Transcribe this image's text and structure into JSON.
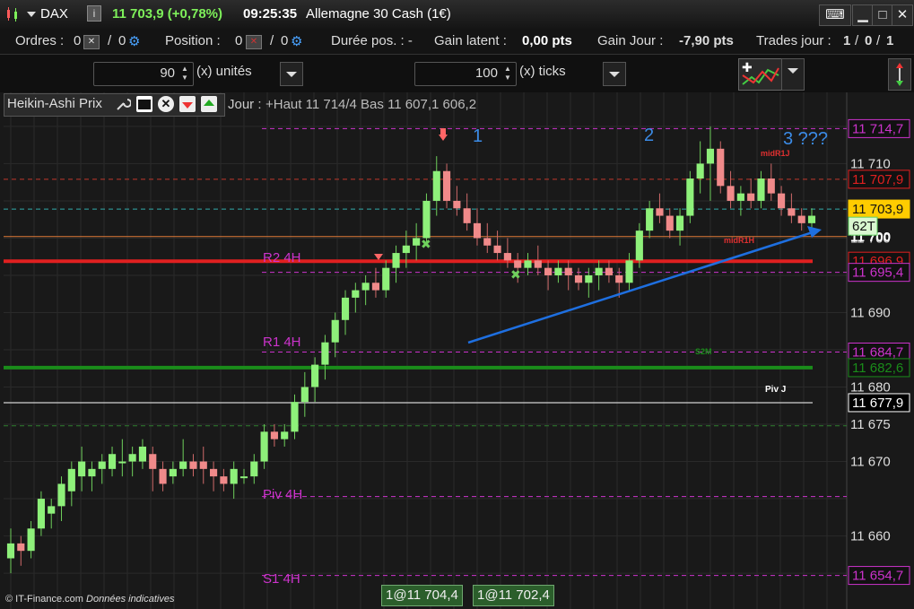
{
  "titlebar": {
    "symbol": "DAX",
    "info": "i",
    "price": "11 703,9 (+0,78%)",
    "time": "09:25:35",
    "instrument": "Allemagne 30 Cash (1€)"
  },
  "orders": {
    "ordres_label": "Ordres :",
    "ordres_v1": "0",
    "ordres_sep": "/",
    "ordres_v2": "0",
    "position_label": "Position :",
    "position_v1": "0",
    "position_sep": "/",
    "position_v2": "0",
    "duree_label": "Durée pos. : -",
    "gain_latent_label": "Gain latent :",
    "gain_latent_value": "0,00 pts",
    "gain_jour_label": "Gain Jour :",
    "gain_jour_value": "-7,90 pts",
    "trades_label": "Trades jour :",
    "trades_v1": "1",
    "trades_v2": "0",
    "trades_v3": "1",
    "slash": "/"
  },
  "toolbar": {
    "qty_value": "90",
    "qty_unit": "(x) unités",
    "ticks_value": "100",
    "ticks_unit": "(x) ticks"
  },
  "chart_header": {
    "name": "Heikin-Ashi Prix",
    "jour": "Jour :",
    "ohlc_overlap": "+Haut 11 714/4 Bas 11 607,1 606,2"
  },
  "chart_data": {
    "type": "candlestick",
    "style": "heikin-ashi",
    "y_ticks": [
      11660,
      11665,
      11670,
      11675,
      11680,
      11685,
      11690,
      11695,
      11700,
      11705,
      11710,
      11715
    ],
    "y_tick_labels": [
      "11 660",
      "11 670",
      "11 675",
      "11 680",
      "11 690",
      "11 700",
      "11 710"
    ],
    "current": "11 700",
    "ylim": [
      11652,
      11718
    ],
    "levels": [
      {
        "name": "R2 4H",
        "price": 11695.4,
        "label": "11 695,4",
        "color": "#cc33cc",
        "style": "dashed"
      },
      {
        "name": "R1 4H",
        "price": 11684.7,
        "label": "11 684,7",
        "color": "#cc33cc",
        "style": "dashed"
      },
      {
        "name": "Piv 4H",
        "price": 11665.3,
        "label": "",
        "color": "#cc33cc",
        "style": "dashed"
      },
      {
        "name": "S1 4H",
        "price": 11654.7,
        "label": "11 654,7",
        "color": "#cc33cc",
        "style": "dashed"
      },
      {
        "name": "",
        "price": 11714.7,
        "label": "11 714,7",
        "color": "#cc33cc",
        "style": "dashed"
      },
      {
        "name": "",
        "price": 11707.9,
        "label": "11 707,9",
        "color": "#c0392b",
        "style": "dashed"
      },
      {
        "name": "",
        "price": 11703.9,
        "label": "11 703,9",
        "color": "#3aa",
        "style": "dashed"
      },
      {
        "name": "",
        "price": 11700.2,
        "label": "",
        "color": "#e07b39",
        "style": "solid"
      },
      {
        "name": "",
        "price": 11696.9,
        "label": "11 696,9",
        "color": "#e02020",
        "style": "solid"
      },
      {
        "name": "",
        "price": 11682.6,
        "label": "11 682,6",
        "color": "#1a8c1a",
        "style": "solid"
      },
      {
        "name": "Piv J",
        "price": 11677.9,
        "label": "11 677,9",
        "color": "#ffffff",
        "style": "solid"
      },
      {
        "name": "",
        "price": 11674.8,
        "label": "",
        "color": "#2f7f2f",
        "style": "dashed"
      }
    ],
    "price_badges": [
      {
        "text": "11 714,7",
        "color": "#cc33cc"
      },
      {
        "text": "11 707,9",
        "color": "#e02020"
      },
      {
        "text": "11 703,9",
        "color": "#ffcc00"
      },
      {
        "text": "62T",
        "color": "#5fcf5f"
      },
      {
        "text": "11 696,9",
        "color": "#e02020"
      },
      {
        "text": "11 695,4",
        "color": "#cc33cc"
      },
      {
        "text": "11 684,7",
        "color": "#cc33cc"
      },
      {
        "text": "11 682,6",
        "color": "#1a8c1a"
      },
      {
        "text": "11 677,9",
        "color": "#ffffff"
      },
      {
        "text": "11 654,7",
        "color": "#cc33cc"
      }
    ],
    "annotations": [
      "1",
      "2",
      "3 ???",
      "midR1J",
      "midR1H",
      "S2M",
      "Piv J",
      "R2 4H",
      "R1 4H",
      "Piv 4H",
      "S1 4H"
    ],
    "candles": [
      [
        11657,
        11661,
        11655,
        11659
      ],
      [
        11659,
        11660,
        11656,
        11658
      ],
      [
        11658,
        11662,
        11657,
        11661
      ],
      [
        11661,
        11666,
        11660,
        11665
      ],
      [
        11663,
        11665,
        11661,
        11664
      ],
      [
        11664,
        11668,
        11662,
        11667
      ],
      [
        11666,
        11670,
        11664,
        11669
      ],
      [
        11668,
        11672,
        11666,
        11670
      ],
      [
        11668,
        11670,
        11666,
        11669
      ],
      [
        11669,
        11671,
        11667,
        11670
      ],
      [
        11669,
        11672,
        11668,
        11671
      ],
      [
        11670,
        11673,
        11668,
        11670
      ],
      [
        11670,
        11672,
        11668,
        11671
      ],
      [
        11670,
        11673,
        11669,
        11672
      ],
      [
        11671,
        11672,
        11666,
        11669
      ],
      [
        11669,
        11670,
        11666,
        11667
      ],
      [
        11668,
        11670,
        11667,
        11669
      ],
      [
        11669,
        11673,
        11668,
        11670
      ],
      [
        11670,
        11671,
        11668,
        11669
      ],
      [
        11670,
        11672,
        11667,
        11669
      ],
      [
        11669,
        11670,
        11666,
        11668
      ],
      [
        11668,
        11669,
        11666,
        11667
      ],
      [
        11667,
        11670,
        11665,
        11669
      ],
      [
        11668,
        11669,
        11667,
        11668
      ],
      [
        11668,
        11671,
        11667,
        11670
      ],
      [
        11670,
        11675,
        11669,
        11674
      ],
      [
        11674,
        11675,
        11672,
        11673
      ],
      [
        11673,
        11675,
        11672,
        11674
      ],
      [
        11674,
        11679,
        11673,
        11678
      ],
      [
        11678,
        11682,
        11676,
        11680
      ],
      [
        11680,
        11684,
        11678,
        11683
      ],
      [
        11683,
        11687,
        11681,
        11686
      ],
      [
        11686,
        11690,
        11684,
        11689
      ],
      [
        11689,
        11693,
        11687,
        11692
      ],
      [
        11692,
        11694,
        11690,
        11693
      ],
      [
        11693,
        11695,
        11691,
        11694
      ],
      [
        11694,
        11696,
        11692,
        11693
      ],
      [
        11693,
        11697,
        11692,
        11696
      ],
      [
        11696,
        11699,
        11694,
        11698
      ],
      [
        11698,
        11701,
        11696,
        11699
      ],
      [
        11699,
        11702,
        11697,
        11700
      ],
      [
        11700,
        11706,
        11699,
        11705
      ],
      [
        11705,
        11711,
        11703,
        11709
      ],
      [
        11709,
        11710,
        11704,
        11705
      ],
      [
        11705,
        11707,
        11703,
        11704
      ],
      [
        11704,
        11706,
        11701,
        11702
      ],
      [
        11702,
        11704,
        11699,
        11700
      ],
      [
        11700,
        11702,
        11698,
        11699
      ],
      [
        11699,
        11701,
        11697,
        11698
      ],
      [
        11698,
        11700,
        11696,
        11697
      ],
      [
        11697,
        11698,
        11694,
        11696
      ],
      [
        11696,
        11698,
        11695,
        11697
      ],
      [
        11697,
        11699,
        11695,
        11696
      ],
      [
        11696,
        11697,
        11693,
        11695
      ],
      [
        11695,
        11697,
        11694,
        11696
      ],
      [
        11696,
        11697,
        11693,
        11695
      ],
      [
        11695,
        11696,
        11693,
        11694
      ],
      [
        11694,
        11696,
        11692,
        11695
      ],
      [
        11695,
        11697,
        11693,
        11696
      ],
      [
        11696,
        11697,
        11694,
        11695
      ],
      [
        11695,
        11696,
        11692,
        11694
      ],
      [
        11694,
        11698,
        11693,
        11697
      ],
      [
        11697,
        11702,
        11696,
        11701
      ],
      [
        11701,
        11705,
        11700,
        11704
      ],
      [
        11704,
        11706,
        11702,
        11703
      ],
      [
        11703,
        11704,
        11700,
        11701
      ],
      [
        11701,
        11704,
        11699,
        11703
      ],
      [
        11703,
        11709,
        11702,
        11708
      ],
      [
        11708,
        11713,
        11706,
        11710
      ],
      [
        11710,
        11715,
        11705,
        11712
      ],
      [
        11712,
        11713,
        11706,
        11707
      ],
      [
        11707,
        11709,
        11704,
        11705
      ],
      [
        11705,
        11707,
        11703,
        11706
      ],
      [
        11706,
        11708,
        11704,
        11705
      ],
      [
        11705,
        11709,
        11704,
        11708
      ],
      [
        11708,
        11710,
        11705,
        11706
      ],
      [
        11706,
        11707,
        11703,
        11704
      ],
      [
        11704,
        11706,
        11702,
        11703
      ],
      [
        11703,
        11704,
        11701,
        11702
      ],
      [
        11702,
        11704,
        11701,
        11703
      ]
    ]
  },
  "footer": {
    "copyright": "© IT-Finance.com",
    "note": "Données indicatives",
    "order1": "1@11 704,4",
    "order2": "1@11 702,4"
  }
}
